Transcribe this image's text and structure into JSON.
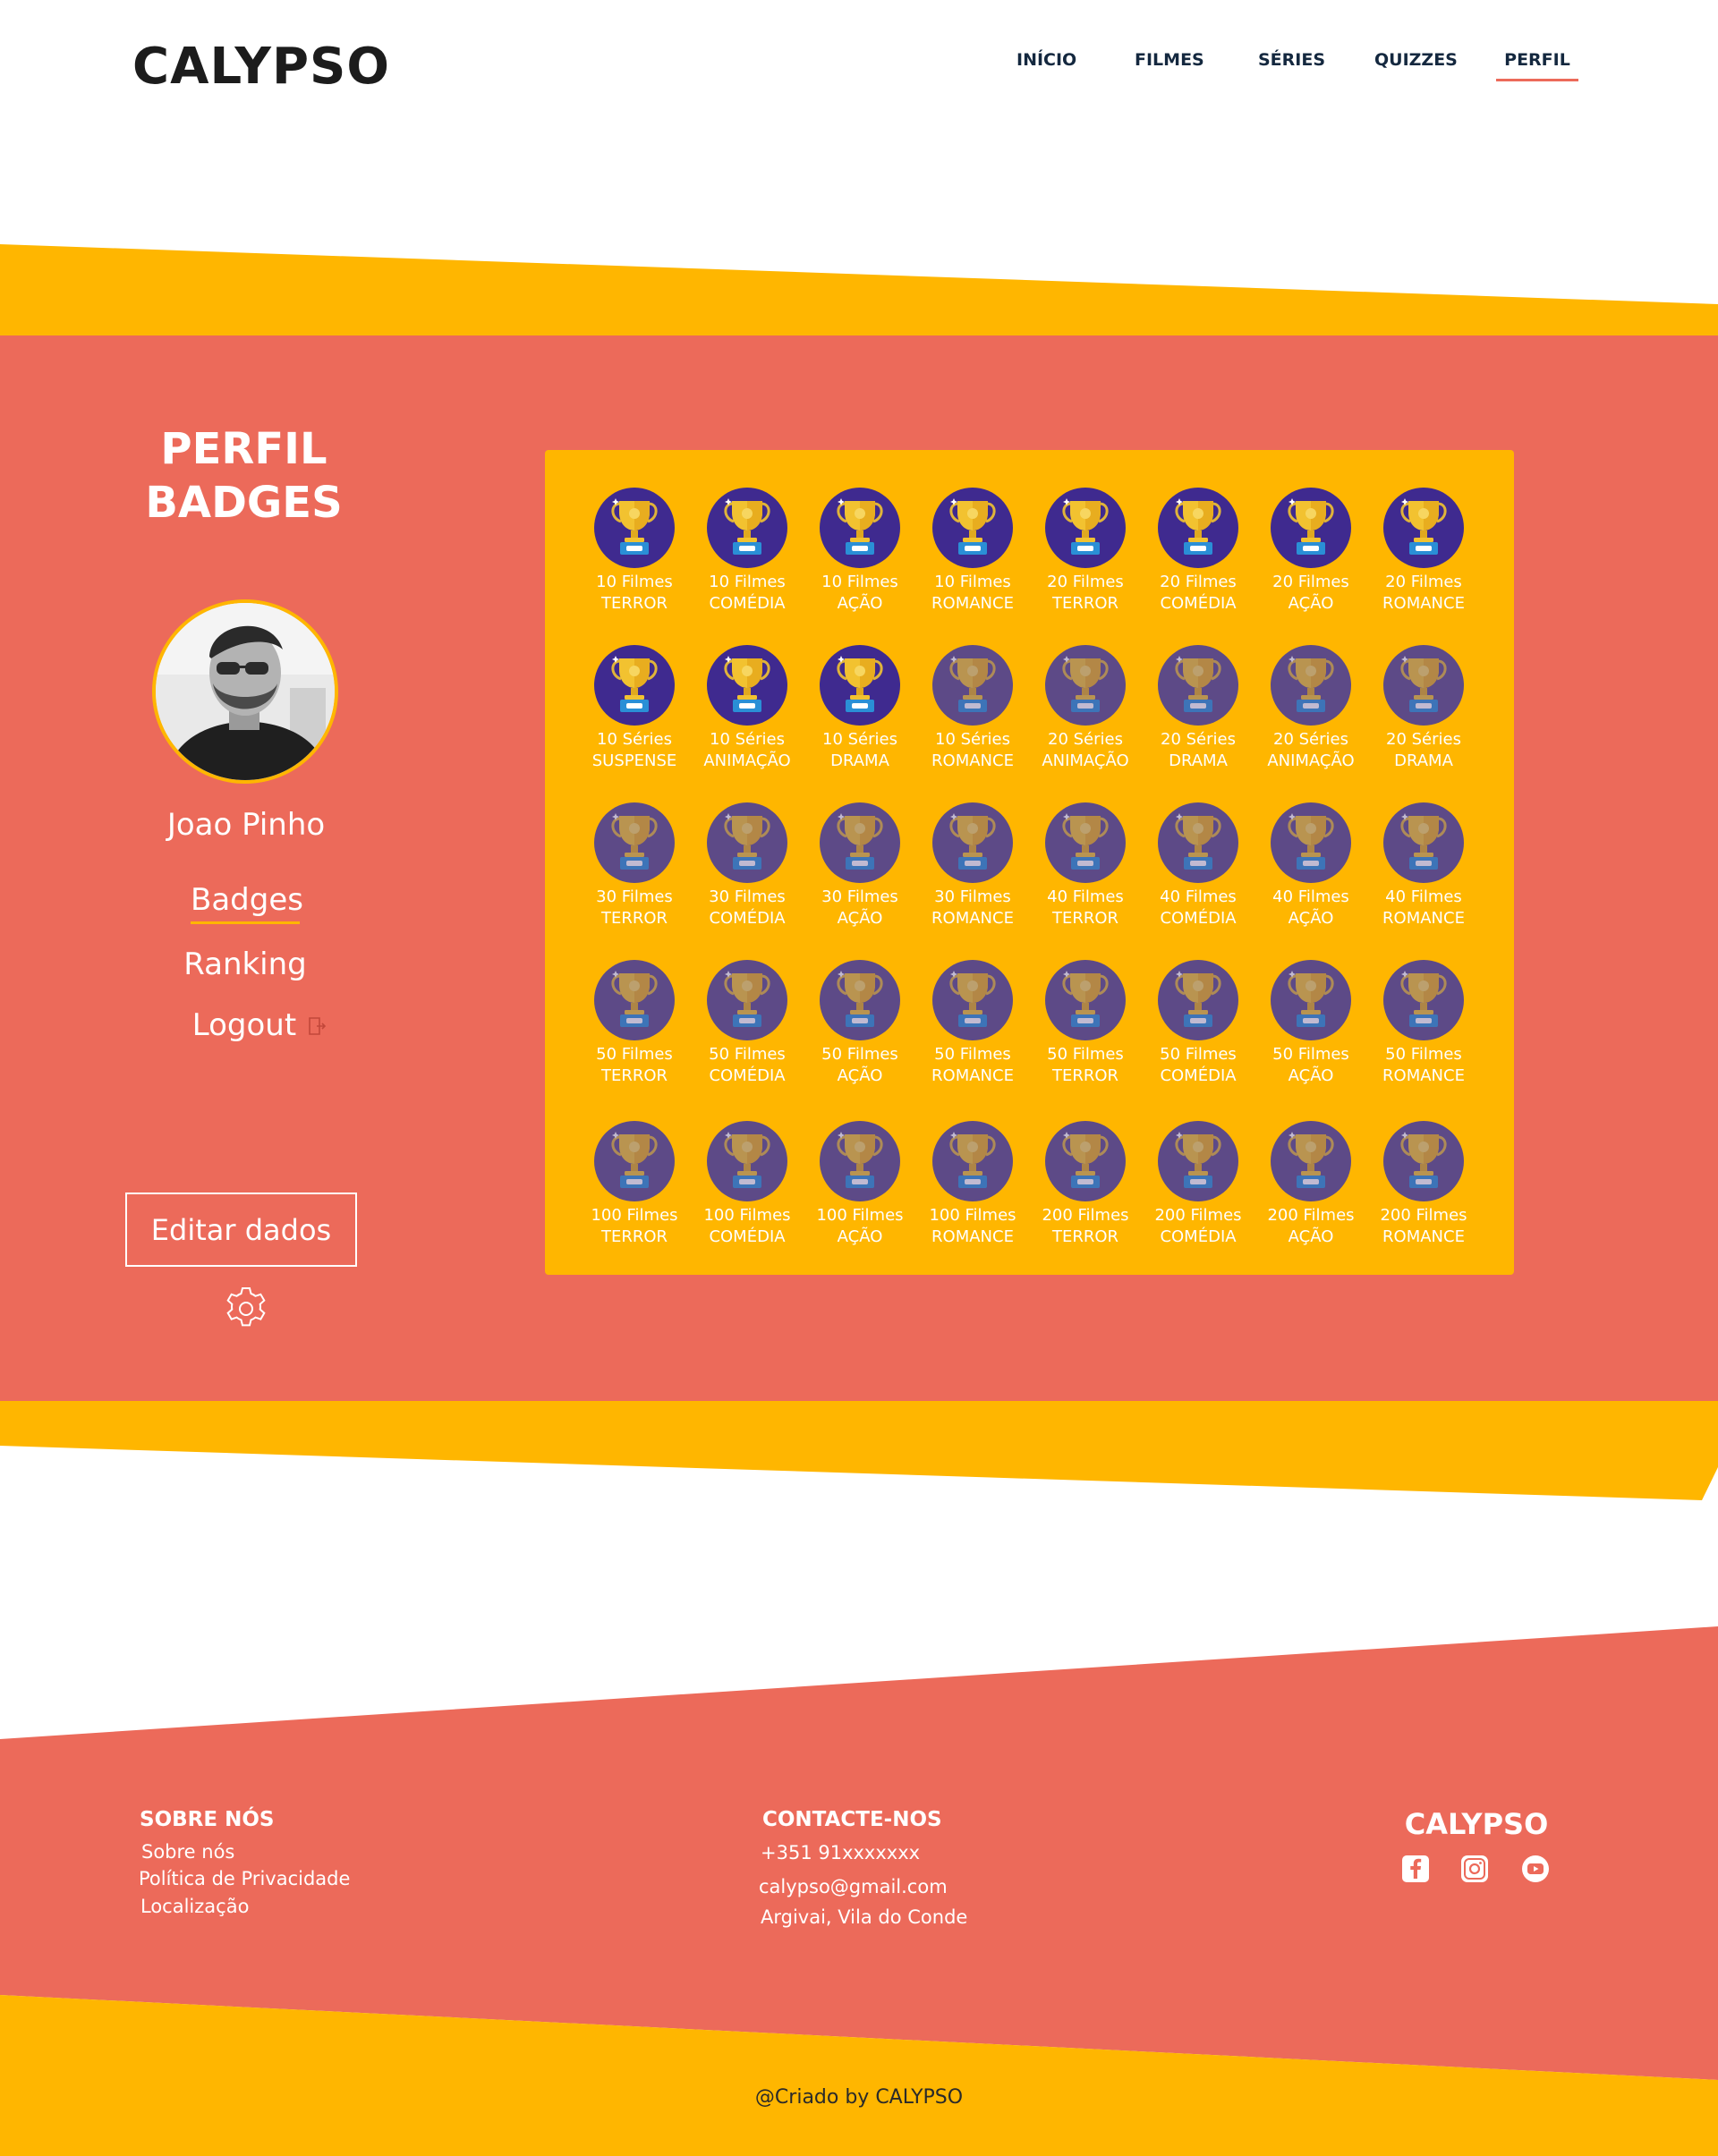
{
  "brand": "CALYPSO",
  "nav": {
    "items": [
      {
        "label": "INÍCIO"
      },
      {
        "label": "FILMES"
      },
      {
        "label": "SÉRIES"
      },
      {
        "label": "QUIZZES"
      },
      {
        "label": "PERFIL",
        "active": true
      }
    ]
  },
  "profile": {
    "title_line1": "PERFIL",
    "title_line2": "BADGES",
    "name": "Joao Pinho",
    "links": {
      "badges": "Badges",
      "ranking": "Ranking",
      "logout": "Logout"
    },
    "edit_button": "Editar dados"
  },
  "badges": [
    {
      "count": "10 Filmes",
      "genre": "TERROR",
      "unlocked": true
    },
    {
      "count": "10 Filmes",
      "genre": "COMÉDIA",
      "unlocked": true
    },
    {
      "count": "10 Filmes",
      "genre": "AÇÃO",
      "unlocked": true
    },
    {
      "count": "10 Filmes",
      "genre": "ROMANCE",
      "unlocked": true
    },
    {
      "count": "20 Filmes",
      "genre": "TERROR",
      "unlocked": true
    },
    {
      "count": "20 Filmes",
      "genre": "COMÉDIA",
      "unlocked": true
    },
    {
      "count": "20 Filmes",
      "genre": "AÇÃO",
      "unlocked": true
    },
    {
      "count": "20 Filmes",
      "genre": "ROMANCE",
      "unlocked": true
    },
    {
      "count": "10 Séries",
      "genre": "SUSPENSE",
      "unlocked": true
    },
    {
      "count": "10 Séries",
      "genre": "ANIMAÇÃO",
      "unlocked": true
    },
    {
      "count": "10 Séries",
      "genre": "DRAMA",
      "unlocked": true
    },
    {
      "count": "10 Séries",
      "genre": "ROMANCE",
      "unlocked": false
    },
    {
      "count": "20 Séries",
      "genre": "ANIMAÇÃO",
      "unlocked": false
    },
    {
      "count": "20 Séries",
      "genre": "DRAMA",
      "unlocked": false
    },
    {
      "count": "20 Séries",
      "genre": "ANIMAÇÃO",
      "unlocked": false
    },
    {
      "count": "20 Séries",
      "genre": "DRAMA",
      "unlocked": false
    },
    {
      "count": "30 Filmes",
      "genre": "TERROR",
      "unlocked": false
    },
    {
      "count": "30 Filmes",
      "genre": "COMÉDIA",
      "unlocked": false
    },
    {
      "count": "30 Filmes",
      "genre": "AÇÃO",
      "unlocked": false
    },
    {
      "count": "30 Filmes",
      "genre": "ROMANCE",
      "unlocked": false
    },
    {
      "count": "40 Filmes",
      "genre": "TERROR",
      "unlocked": false
    },
    {
      "count": "40 Filmes",
      "genre": "COMÉDIA",
      "unlocked": false
    },
    {
      "count": "40 Filmes",
      "genre": "AÇÃO",
      "unlocked": false
    },
    {
      "count": "40 Filmes",
      "genre": "ROMANCE",
      "unlocked": false
    },
    {
      "count": "50 Filmes",
      "genre": "TERROR",
      "unlocked": false
    },
    {
      "count": "50 Filmes",
      "genre": "COMÉDIA",
      "unlocked": false
    },
    {
      "count": "50 Filmes",
      "genre": "AÇÃO",
      "unlocked": false
    },
    {
      "count": "50 Filmes",
      "genre": "ROMANCE",
      "unlocked": false
    },
    {
      "count": "50 Filmes",
      "genre": "TERROR",
      "unlocked": false
    },
    {
      "count": "50 Filmes",
      "genre": "COMÉDIA",
      "unlocked": false
    },
    {
      "count": "50 Filmes",
      "genre": "AÇÃO",
      "unlocked": false
    },
    {
      "count": "50 Filmes",
      "genre": "ROMANCE",
      "unlocked": false
    },
    {
      "count": "100 Filmes",
      "genre": "TERROR",
      "unlocked": false
    },
    {
      "count": "100 Filmes",
      "genre": "COMÉDIA",
      "unlocked": false
    },
    {
      "count": "100 Filmes",
      "genre": "AÇÃO",
      "unlocked": false
    },
    {
      "count": "100 Filmes",
      "genre": "ROMANCE",
      "unlocked": false
    },
    {
      "count": "200 Filmes",
      "genre": "TERROR",
      "unlocked": false
    },
    {
      "count": "200 Filmes",
      "genre": "COMÉDIA",
      "unlocked": false
    },
    {
      "count": "200 Filmes",
      "genre": "AÇÃO",
      "unlocked": false
    },
    {
      "count": "200 Filmes",
      "genre": "ROMANCE",
      "unlocked": false
    }
  ],
  "footer": {
    "about": {
      "title": "SOBRE NÓS",
      "links": [
        "Sobre nós",
        "Política de Privacidade",
        "Localização"
      ]
    },
    "contact": {
      "title": "CONTACTE-NOS",
      "phone": "+351 91xxxxxxx",
      "email": "calypso@gmail.com",
      "address": "Argivai, Vila do Conde"
    },
    "brand": "CALYPSO",
    "social_icons": [
      "facebook-icon",
      "instagram-icon",
      "youtube-icon"
    ],
    "copyright": "@Criado by CALYPSO"
  },
  "colors": {
    "coral": "#ec6a5a",
    "yellow": "#ffb600",
    "badge_purple": "#3f2a8f",
    "dark_text": "#14283f"
  }
}
